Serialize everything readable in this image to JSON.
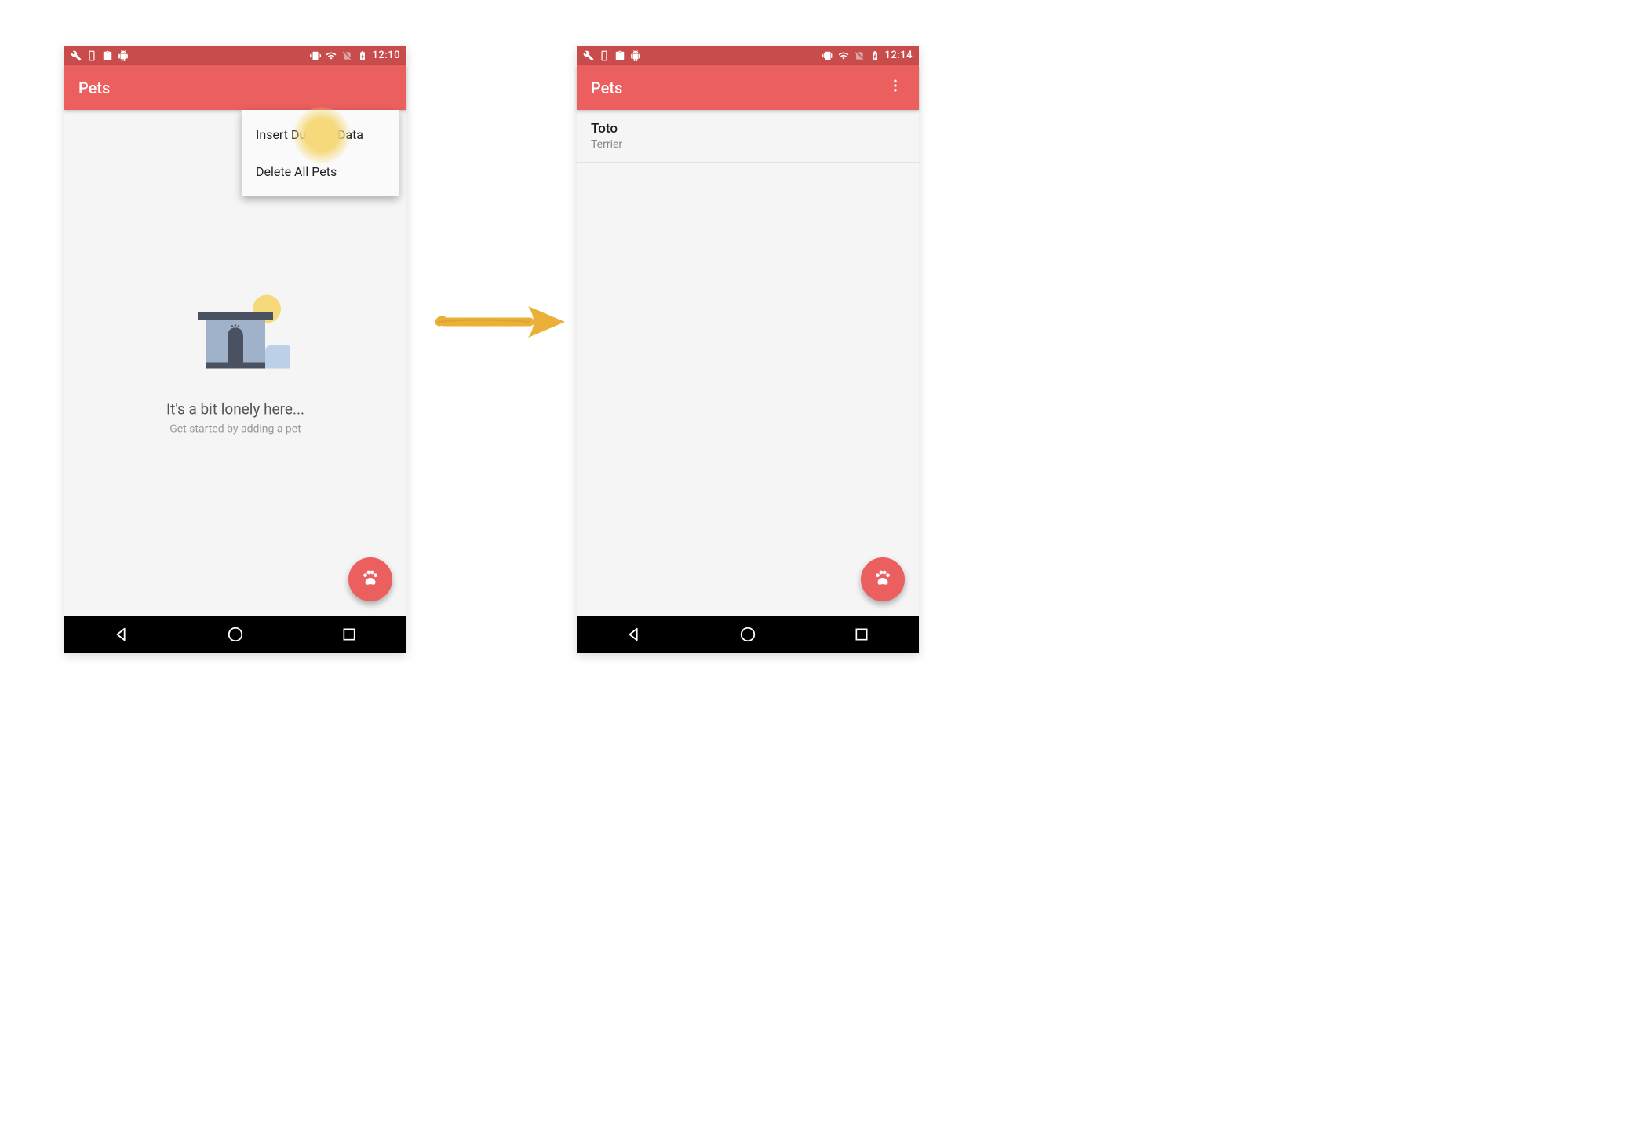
{
  "screens": {
    "left": {
      "status_time": "12:10",
      "app_title": "Pets",
      "menu": {
        "item1": "Insert Dummy Data",
        "item2": "Delete All Pets"
      },
      "empty": {
        "title": "It's a bit lonely here...",
        "subtitle": "Get started by adding a pet"
      }
    },
    "right": {
      "status_time": "12:14",
      "app_title": "Pets",
      "list": {
        "item1": {
          "name": "Toto",
          "breed": "Terrier"
        }
      }
    }
  },
  "colors": {
    "status_bar": "#c94c4c",
    "action_bar": "#ec5f5f",
    "fab": "#ec5f5f",
    "arrow": "#eab037"
  }
}
